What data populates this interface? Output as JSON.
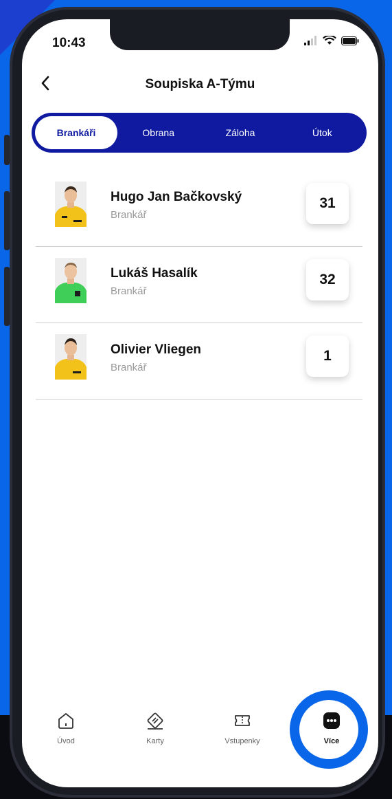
{
  "status_bar": {
    "time": "10:43"
  },
  "header": {
    "title": "Soupiska A-Týmu"
  },
  "tabs": [
    {
      "label": "Brankáři",
      "active": true
    },
    {
      "label": "Obrana",
      "active": false
    },
    {
      "label": "Záloha",
      "active": false
    },
    {
      "label": "Útok",
      "active": false
    }
  ],
  "players": [
    {
      "name": "Hugo Jan Bačkovský",
      "position": "Brankář",
      "number": "31",
      "jersey_color": "#f2c21a"
    },
    {
      "name": "Lukáš Hasalík",
      "position": "Brankář",
      "number": "32",
      "jersey_color": "#3fcf58"
    },
    {
      "name": "Olivier Vliegen",
      "position": "Brankář",
      "number": "1",
      "jersey_color": "#f2c21a"
    }
  ],
  "bottom_nav": [
    {
      "label": "Úvod",
      "icon": "home-icon",
      "active": false
    },
    {
      "label": "Karty",
      "icon": "card-icon",
      "active": false
    },
    {
      "label": "Vstupenky",
      "icon": "ticket-icon",
      "active": false
    },
    {
      "label": "Více",
      "icon": "more-icon",
      "active": true
    }
  ],
  "colors": {
    "accent": "#0f1aa0",
    "highlight": "#0a66e8"
  }
}
